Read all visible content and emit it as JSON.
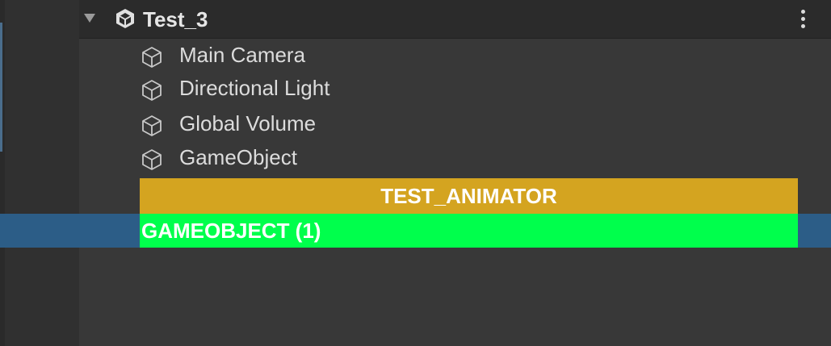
{
  "scene": {
    "title": "Test_3",
    "icon": "unity-scene-icon",
    "menu_icon": "kebab-menu-icon"
  },
  "hierarchy": {
    "items": [
      {
        "label": "Main Camera",
        "icon": "cube-icon"
      },
      {
        "label": "Directional Light",
        "icon": "cube-icon"
      },
      {
        "label": "Global Volume",
        "icon": "cube-icon"
      },
      {
        "label": "GameObject",
        "icon": "cube-icon"
      }
    ],
    "headers": [
      {
        "label": "TEST_ANIMATOR",
        "color": "#d4a420",
        "align": "center"
      },
      {
        "label": "GAMEOBJECT (1)",
        "color": "#00ff4c",
        "align": "left",
        "selected": true
      }
    ]
  },
  "colors": {
    "background": "#383838",
    "selection": "#2c5d87"
  }
}
